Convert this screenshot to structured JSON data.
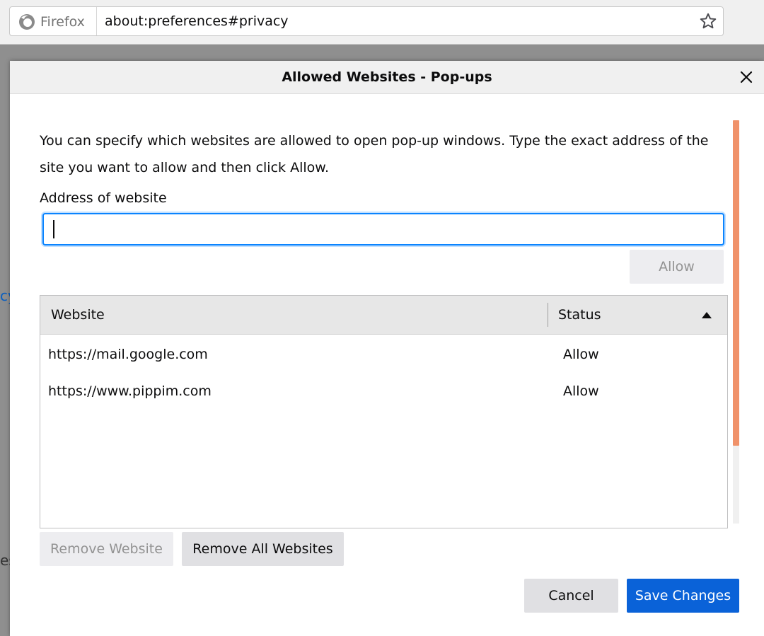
{
  "browser": {
    "identity_label": "Firefox",
    "url": "about:preferences#privacy"
  },
  "background_page": {
    "link_fragment": "cy",
    "text_fragment": "es"
  },
  "dialog": {
    "title": "Allowed Websites - Pop-ups",
    "description": "You can specify which websites are allowed to open pop-up windows. Type the exact address of the site you want to allow and then click Allow.",
    "address_label": "Address of website",
    "address_value": "",
    "allow_button": "Allow",
    "table": {
      "columns": [
        "Website",
        "Status"
      ],
      "rows": [
        {
          "website": "https://mail.google.com",
          "status": "Allow"
        },
        {
          "website": "https://www.pippim.com",
          "status": "Allow"
        }
      ]
    },
    "remove_website_button": "Remove Website",
    "remove_all_button": "Remove All Websites",
    "cancel_button": "Cancel",
    "save_button": "Save Changes"
  },
  "colors": {
    "accent": "#0a84ff",
    "primary_button": "#0a62d8",
    "scrollbar_thumb": "#f0926a",
    "link": "#0a5fc0"
  },
  "icons": {
    "identity": "firefox-logo-icon",
    "bookmark": "star-icon",
    "close": "close-icon",
    "sort": "sort-ascending-icon"
  }
}
